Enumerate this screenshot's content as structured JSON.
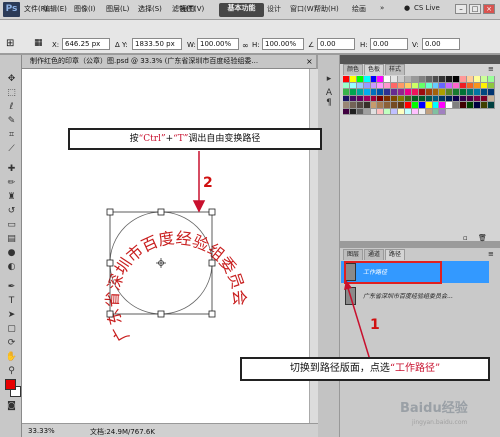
{
  "app": {
    "logo": "Ps"
  },
  "menu": [
    "文件(F)",
    "编辑(E)",
    "图像(I)",
    "图层(L)",
    "选择(S)",
    "滤镜(T)",
    "视图(V)",
    "窗口(W)",
    "帮助(H)"
  ],
  "workspace": {
    "essentials": "基本功能",
    "design": "设计",
    "paint": "绘画",
    "more": "»",
    "cslive": "CS Live"
  },
  "window_buttons": {
    "minimize": "–",
    "restore": "□",
    "close": "×"
  },
  "options": {
    "x_label": "X:",
    "x_value": "646.25 px",
    "y_label": "Y:",
    "y_value": "1833.50 px",
    "w_label": "W:",
    "w_value": "100.00%",
    "h_label": "H:",
    "h_value": "100.00%",
    "angle_value": "0.00",
    "skew_h_label": "H:",
    "skew_h_value": "0.00",
    "skew_v_label": "V:",
    "skew_v_value": "0.00"
  },
  "document": {
    "tab_title": "制作红色的印章（公章）图.psd @ 33.3% (广东省深圳市百度经验组委...",
    "tab_close": "×",
    "stamp_text": "广东省深圳市百度经验组委员会",
    "zoom": "33.33%",
    "doc_size": "文档:24.9M/767.6K"
  },
  "panels": {
    "swatch_tabs": [
      "颜色",
      "色板",
      "样式"
    ],
    "swatch_colors": [
      "#ff0000",
      "#ffff00",
      "#00ff00",
      "#00ffff",
      "#0000ff",
      "#ff00ff",
      "#ffffff",
      "#e6e6e6",
      "#cccccc",
      "#b3b3b3",
      "#999999",
      "#808080",
      "#666666",
      "#4d4d4d",
      "#333333",
      "#1a1a1a",
      "#000000",
      "#ff9999",
      "#ffcc99",
      "#ffff99",
      "#ccff99",
      "#99ff99",
      "#99ffcc",
      "#99ffff",
      "#99ccff",
      "#9999ff",
      "#cc99ff",
      "#ff99ff",
      "#ff99cc",
      "#ff6666",
      "#ff9966",
      "#ffcc66",
      "#ccff66",
      "#66ff66",
      "#66ffcc",
      "#66ccff",
      "#6666ff",
      "#cc66ff",
      "#ff66cc",
      "#ee1c24",
      "#f26522",
      "#f7941d",
      "#fff200",
      "#8dc63f",
      "#39b54a",
      "#00a651",
      "#00a99d",
      "#00aeef",
      "#0072bc",
      "#0054a6",
      "#2e3192",
      "#662d91",
      "#92278f",
      "#ec008c",
      "#ed145b",
      "#9e0b0f",
      "#a0410d",
      "#a3620a",
      "#aba000",
      "#598527",
      "#197b30",
      "#007236",
      "#00746b",
      "#0076a3",
      "#004a80",
      "#003471",
      "#1b1464",
      "#440e62",
      "#630460",
      "#9e005d",
      "#9e0039",
      "#790000",
      "#7b2e00",
      "#7d4900",
      "#827b00",
      "#406618",
      "#005e20",
      "#005826",
      "#005952",
      "#005b7f",
      "#003663",
      "#002157",
      "#0d004c",
      "#32004b",
      "#4b0049",
      "#7b0046",
      "#7a0026",
      "#c7b299",
      "#998675",
      "#736357",
      "#534741",
      "#37302a",
      "#c69c6d",
      "#a67c52",
      "#8c6239",
      "#754c24",
      "#603913",
      "#ff0000",
      "#00ff00",
      "#0000ff",
      "#ffff00",
      "#00ffff",
      "#ff00ff",
      "#ffffff",
      "#808080",
      "#400000",
      "#004000",
      "#000040",
      "#404000",
      "#004040",
      "#400040",
      "#202020",
      "#606060",
      "#a0a0a0",
      "#e0e0e0",
      "#ffc0c0",
      "#c0ffc0",
      "#c0c0ff",
      "#ffffc0",
      "#c0ffff",
      "#ffc0ff",
      "#f0f0f0",
      "#c0a080",
      "#80c0a0",
      "#a080c0"
    ],
    "paths_tabs": [
      "图层",
      "通道",
      "路径"
    ],
    "path_items": [
      "工作路径",
      "广东省深圳市百度经验组委员会..."
    ]
  },
  "annotations": {
    "step2_prefix": "按",
    "step2_key1": "“Ctrl”",
    "step2_plus": "+",
    "step2_key2": "“T”",
    "step2_suffix": "调出自由变换路径",
    "step2_number": "2",
    "step1_prefix": "切换到路径版面，点选",
    "step1_highlight": "“工作路径”",
    "step1_number": "1"
  },
  "watermark": {
    "text": "Baidu经验",
    "sub": "jingyan.baidu.com"
  },
  "colors": {
    "accent": "#d01010",
    "selection": "#3399ff",
    "fg": "#e60000",
    "bg": "#ffffff"
  }
}
